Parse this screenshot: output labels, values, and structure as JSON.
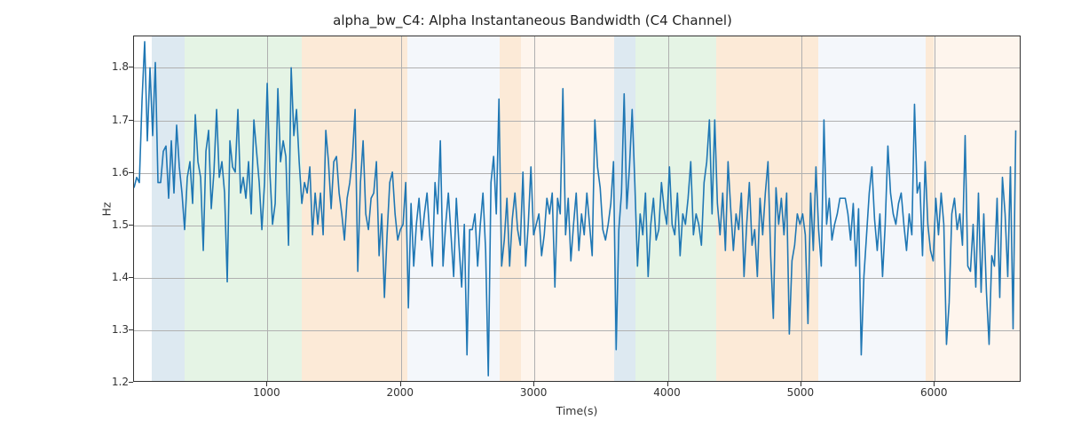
{
  "chart_data": {
    "type": "line",
    "title": "alpha_bw_C4: Alpha Instantaneous Bandwidth (C4 Channel)",
    "xlabel": "Time(s)",
    "ylabel": "Hz",
    "xlim": [
      0,
      6650
    ],
    "ylim": [
      1.2,
      1.86
    ],
    "xticks": [
      1000,
      2000,
      3000,
      4000,
      5000,
      6000
    ],
    "yticks": [
      1.2,
      1.3,
      1.4,
      1.5,
      1.6,
      1.7,
      1.8
    ],
    "line_color": "#1f77b4",
    "bands": [
      {
        "x0": 130,
        "x1": 380,
        "color": "#9fc0d7"
      },
      {
        "x0": 380,
        "x1": 1260,
        "color": "#b5e0b5"
      },
      {
        "x0": 1260,
        "x1": 2050,
        "color": "#f6c28b"
      },
      {
        "x0": 2050,
        "x1": 2740,
        "color": "#dfe8f3"
      },
      {
        "x0": 2740,
        "x1": 2900,
        "color": "#f6c28b"
      },
      {
        "x0": 2900,
        "x1": 3600,
        "color": "#fbe3cc"
      },
      {
        "x0": 3600,
        "x1": 3760,
        "color": "#9fc0d7"
      },
      {
        "x0": 3760,
        "x1": 4360,
        "color": "#b5e0b5"
      },
      {
        "x0": 4360,
        "x1": 5130,
        "color": "#f6c28b"
      },
      {
        "x0": 5130,
        "x1": 5930,
        "color": "#dfe8f3"
      },
      {
        "x0": 5930,
        "x1": 5990,
        "color": "#f6c28b"
      },
      {
        "x0": 5990,
        "x1": 6650,
        "color": "#fbe3cc"
      }
    ],
    "x": [
      0,
      20,
      40,
      60,
      80,
      100,
      120,
      140,
      160,
      180,
      200,
      220,
      240,
      260,
      280,
      300,
      320,
      340,
      360,
      380,
      400,
      420,
      440,
      460,
      480,
      500,
      520,
      540,
      560,
      580,
      600,
      620,
      640,
      660,
      680,
      700,
      720,
      740,
      760,
      780,
      800,
      820,
      840,
      860,
      880,
      900,
      920,
      940,
      960,
      980,
      1000,
      1020,
      1040,
      1060,
      1080,
      1100,
      1120,
      1140,
      1160,
      1180,
      1200,
      1220,
      1240,
      1260,
      1280,
      1300,
      1320,
      1340,
      1360,
      1380,
      1400,
      1420,
      1440,
      1460,
      1480,
      1500,
      1520,
      1540,
      1560,
      1580,
      1600,
      1620,
      1640,
      1660,
      1680,
      1700,
      1720,
      1740,
      1760,
      1780,
      1800,
      1820,
      1840,
      1860,
      1880,
      1900,
      1920,
      1940,
      1960,
      1980,
      2000,
      2020,
      2040,
      2060,
      2080,
      2100,
      2120,
      2140,
      2160,
      2180,
      2200,
      2220,
      2240,
      2260,
      2280,
      2300,
      2320,
      2340,
      2360,
      2380,
      2400,
      2420,
      2440,
      2460,
      2480,
      2500,
      2520,
      2540,
      2560,
      2580,
      2600,
      2620,
      2640,
      2660,
      2680,
      2700,
      2720,
      2740,
      2760,
      2780,
      2800,
      2820,
      2840,
      2860,
      2880,
      2900,
      2920,
      2940,
      2960,
      2980,
      3000,
      3020,
      3040,
      3060,
      3080,
      3100,
      3120,
      3140,
      3160,
      3180,
      3200,
      3220,
      3240,
      3260,
      3280,
      3300,
      3320,
      3340,
      3360,
      3380,
      3400,
      3420,
      3440,
      3460,
      3480,
      3500,
      3520,
      3540,
      3560,
      3580,
      3600,
      3620,
      3640,
      3660,
      3680,
      3700,
      3720,
      3740,
      3760,
      3780,
      3800,
      3820,
      3840,
      3860,
      3880,
      3900,
      3920,
      3940,
      3960,
      3980,
      4000,
      4020,
      4040,
      4060,
      4080,
      4100,
      4120,
      4140,
      4160,
      4180,
      4200,
      4220,
      4240,
      4260,
      4280,
      4300,
      4320,
      4340,
      4360,
      4380,
      4400,
      4420,
      4440,
      4460,
      4480,
      4500,
      4520,
      4540,
      4560,
      4580,
      4600,
      4620,
      4640,
      4660,
      4680,
      4700,
      4720,
      4740,
      4760,
      4780,
      4800,
      4820,
      4840,
      4860,
      4880,
      4900,
      4920,
      4940,
      4960,
      4980,
      5000,
      5020,
      5040,
      5060,
      5080,
      5100,
      5120,
      5140,
      5160,
      5180,
      5200,
      5220,
      5240,
      5260,
      5280,
      5300,
      5320,
      5340,
      5360,
      5380,
      5400,
      5420,
      5440,
      5460,
      5480,
      5500,
      5520,
      5540,
      5560,
      5580,
      5600,
      5620,
      5640,
      5660,
      5680,
      5700,
      5720,
      5740,
      5760,
      5780,
      5800,
      5820,
      5840,
      5860,
      5880,
      5900,
      5920,
      5940,
      5960,
      5980,
      6000,
      6020,
      6040,
      6060,
      6080,
      6100,
      6120,
      6140,
      6160,
      6180,
      6200,
      6220,
      6240,
      6260,
      6280,
      6300,
      6320,
      6340,
      6360,
      6380,
      6400,
      6420,
      6440,
      6460,
      6480,
      6500,
      6520,
      6540,
      6560,
      6580,
      6600,
      6620,
      6640
    ],
    "values": [
      1.57,
      1.59,
      1.58,
      1.736,
      1.85,
      1.66,
      1.8,
      1.67,
      1.81,
      1.58,
      1.58,
      1.64,
      1.65,
      1.55,
      1.66,
      1.56,
      1.69,
      1.61,
      1.56,
      1.49,
      1.59,
      1.62,
      1.54,
      1.71,
      1.62,
      1.59,
      1.45,
      1.64,
      1.68,
      1.53,
      1.6,
      1.72,
      1.59,
      1.62,
      1.56,
      1.39,
      1.66,
      1.61,
      1.6,
      1.72,
      1.56,
      1.59,
      1.55,
      1.62,
      1.52,
      1.7,
      1.64,
      1.58,
      1.49,
      1.58,
      1.77,
      1.6,
      1.5,
      1.54,
      1.76,
      1.62,
      1.66,
      1.63,
      1.46,
      1.8,
      1.67,
      1.72,
      1.62,
      1.54,
      1.58,
      1.56,
      1.61,
      1.48,
      1.56,
      1.5,
      1.56,
      1.48,
      1.68,
      1.62,
      1.53,
      1.62,
      1.63,
      1.56,
      1.52,
      1.47,
      1.55,
      1.58,
      1.63,
      1.72,
      1.41,
      1.58,
      1.66,
      1.52,
      1.49,
      1.55,
      1.56,
      1.62,
      1.44,
      1.52,
      1.36,
      1.48,
      1.58,
      1.6,
      1.52,
      1.47,
      1.49,
      1.5,
      1.58,
      1.34,
      1.54,
      1.42,
      1.5,
      1.55,
      1.47,
      1.52,
      1.56,
      1.48,
      1.42,
      1.58,
      1.52,
      1.66,
      1.42,
      1.5,
      1.56,
      1.48,
      1.4,
      1.55,
      1.46,
      1.38,
      1.5,
      1.25,
      1.49,
      1.49,
      1.52,
      1.42,
      1.5,
      1.56,
      1.45,
      1.21,
      1.58,
      1.63,
      1.52,
      1.74,
      1.42,
      1.47,
      1.55,
      1.42,
      1.51,
      1.56,
      1.49,
      1.46,
      1.6,
      1.42,
      1.5,
      1.61,
      1.48,
      1.5,
      1.52,
      1.44,
      1.48,
      1.55,
      1.52,
      1.56,
      1.38,
      1.55,
      1.52,
      1.76,
      1.48,
      1.55,
      1.43,
      1.5,
      1.56,
      1.45,
      1.52,
      1.48,
      1.56,
      1.5,
      1.44,
      1.7,
      1.61,
      1.57,
      1.49,
      1.47,
      1.5,
      1.54,
      1.62,
      1.26,
      1.49,
      1.56,
      1.75,
      1.53,
      1.61,
      1.72,
      1.58,
      1.42,
      1.52,
      1.48,
      1.56,
      1.4,
      1.5,
      1.55,
      1.47,
      1.49,
      1.58,
      1.53,
      1.5,
      1.61,
      1.5,
      1.48,
      1.56,
      1.44,
      1.52,
      1.5,
      1.55,
      1.62,
      1.48,
      1.52,
      1.5,
      1.46,
      1.58,
      1.62,
      1.7,
      1.52,
      1.7,
      1.54,
      1.48,
      1.56,
      1.45,
      1.62,
      1.53,
      1.45,
      1.52,
      1.49,
      1.56,
      1.4,
      1.5,
      1.58,
      1.46,
      1.49,
      1.4,
      1.55,
      1.48,
      1.56,
      1.62,
      1.44,
      1.32,
      1.57,
      1.5,
      1.55,
      1.48,
      1.56,
      1.29,
      1.43,
      1.46,
      1.52,
      1.5,
      1.52,
      1.48,
      1.31,
      1.56,
      1.45,
      1.61,
      1.49,
      1.42,
      1.7,
      1.5,
      1.55,
      1.47,
      1.5,
      1.52,
      1.55,
      1.55,
      1.55,
      1.52,
      1.47,
      1.54,
      1.42,
      1.53,
      1.25,
      1.4,
      1.48,
      1.56,
      1.61,
      1.51,
      1.45,
      1.52,
      1.4,
      1.5,
      1.65,
      1.56,
      1.52,
      1.5,
      1.54,
      1.56,
      1.5,
      1.45,
      1.52,
      1.48,
      1.73,
      1.56,
      1.58,
      1.44,
      1.62,
      1.5,
      1.45,
      1.43,
      1.55,
      1.48,
      1.56,
      1.5,
      1.27,
      1.35,
      1.52,
      1.55,
      1.49,
      1.52,
      1.46,
      1.67,
      1.42,
      1.41,
      1.5,
      1.38,
      1.56,
      1.37,
      1.52,
      1.37,
      1.27,
      1.44,
      1.42,
      1.55,
      1.36,
      1.59,
      1.52,
      1.4,
      1.61,
      1.3,
      1.68
    ],
    "grid": true
  }
}
